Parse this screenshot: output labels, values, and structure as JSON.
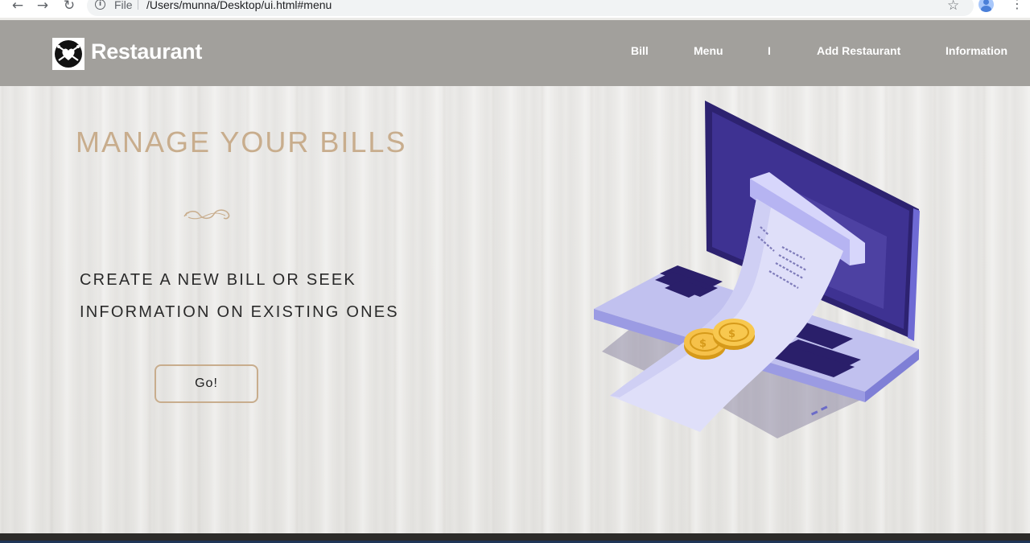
{
  "browser": {
    "back_icon": "arrow-left-icon",
    "forward_icon": "arrow-right-icon",
    "reload_icon": "reload-icon",
    "scheme_label": "File",
    "url": "/Users/munna/Desktop/ui.html#menu",
    "star_icon": "star-icon",
    "profile_icon": "profile-icon",
    "menu_icon": "kebab-menu-icon"
  },
  "header": {
    "logo_icon": "restaurant-logo-icon",
    "brand": "Restaurant",
    "nav": [
      {
        "label": "Bill"
      },
      {
        "label": "Menu"
      },
      {
        "label": "I"
      },
      {
        "label": "Add Restaurant"
      },
      {
        "label": "Information"
      }
    ]
  },
  "hero": {
    "title": "MANAGE YOUR BILLS",
    "ornament_icon": "flourish-ornament-icon",
    "subtitle_lines": [
      "CREATE A NEW BILL OR SEEK",
      "INFORMATION ON EXISTING ONES"
    ],
    "button_label": "Go!",
    "illustration": "laptop-receipt-coins-illustration"
  },
  "colors": {
    "header_bg": "#a2a09c",
    "accent": "#c8ad8d",
    "laptop_purple": "#3c2f8a"
  }
}
